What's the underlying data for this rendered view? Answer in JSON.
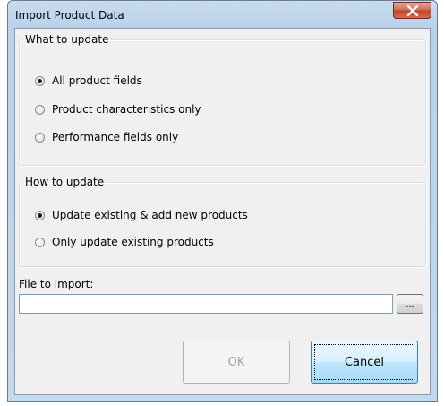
{
  "window": {
    "title": "Import Product Data",
    "close_icon": "close-x"
  },
  "what_to_update": {
    "legend": "What to update",
    "options": [
      {
        "label": "All product fields",
        "checked": true
      },
      {
        "label": "Product characteristics only",
        "checked": false
      },
      {
        "label": "Performance fields only",
        "checked": false
      }
    ]
  },
  "how_to_update": {
    "legend": "How to update",
    "options": [
      {
        "label": "Update existing & add new products",
        "checked": true
      },
      {
        "label": "Only update existing products",
        "checked": false
      }
    ]
  },
  "file": {
    "label": "File to import:",
    "value": "",
    "browse_label": "..."
  },
  "buttons": {
    "ok_label": "OK",
    "ok_enabled": false,
    "cancel_label": "Cancel"
  },
  "colors": {
    "titlebar": "#b9d1ea",
    "dialog_face": "#f0f0f0",
    "close_button": "#c2462d",
    "default_button_accent": "#3c7fb1"
  }
}
